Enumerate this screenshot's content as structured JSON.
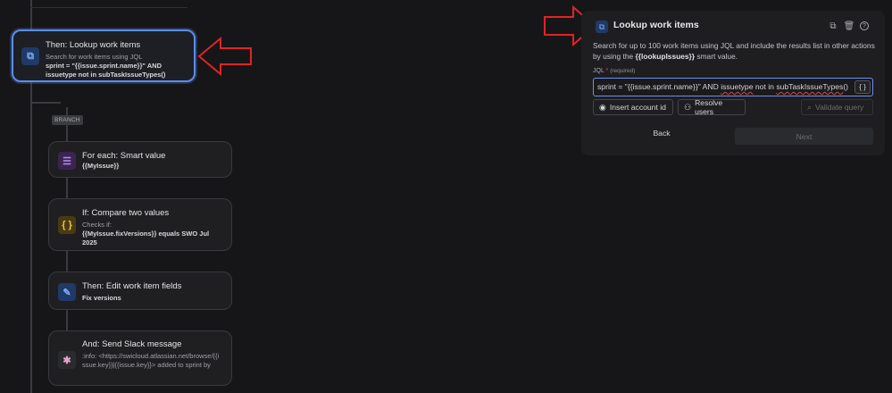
{
  "flow": {
    "branch_label": "BRANCH",
    "cards": [
      {
        "title": "Then: Lookup work items",
        "sub": "Search for work items using JQL",
        "bold": "sprint = \"{{issue.sprint.name}}\" AND issuetype not in subTaskIssueTypes()"
      },
      {
        "title": "For each: Smart value",
        "bold": "{{MyIssue}}"
      },
      {
        "title": "If: Compare two values",
        "sub": "Checks if:",
        "bold": "{{MyIssue.fixVersions}} equals SWO Jul 2025"
      },
      {
        "title": "Then: Edit work item fields",
        "bold": "Fix versions"
      },
      {
        "title": "And: Send Slack message",
        "sub": ":info: <https://swicloud.atlassian.net/browse/{{issue.key}}|{{issue.key}}> added to sprint by"
      }
    ]
  },
  "panel": {
    "title": "Lookup work items",
    "desc_1": "Search for up to 100 work items using JQL and include the results list in other actions by using the ",
    "desc_smart": "{{lookupIssues}}",
    "desc_2": " smart value.",
    "jql_label": "JQL",
    "jql_required": "(required)",
    "jql_part_1": "sprint = \"{{issue.sprint.name}}\" AND ",
    "jql_part_err": "issuetype",
    "jql_part_2": " not in ",
    "jql_part_err2": "subTaskIssueTypes",
    "jql_part_3": "()",
    "braces": "{ }",
    "insert_account": "Insert account id",
    "resolve_users": "Resolve users",
    "validate_query": "Validate query",
    "back": "Back",
    "next": "Next"
  },
  "colors": {
    "accent": "#5b8def",
    "annotation_arrow": "#e02424"
  }
}
